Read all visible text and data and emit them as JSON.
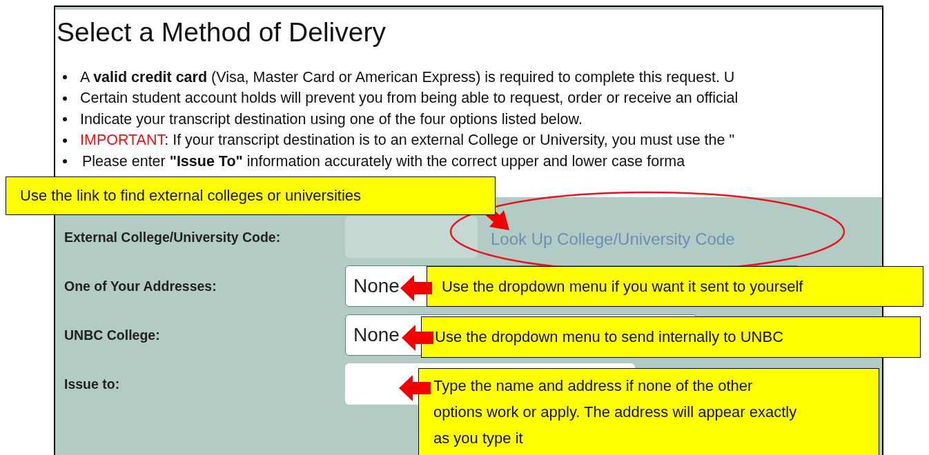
{
  "page": {
    "title": "Select a Method of Delivery",
    "instructions": [
      {
        "text": "A **valid credit card** (Visa, Master Card or American Express) is required to complete this request. U"
      },
      {
        "text": "Certain student account holds will prevent you from being able to request, order or receive an official"
      },
      {
        "text": "Indicate your transcript destination using one of the four options listed below."
      },
      {
        "alert": "IMPORTANT",
        "text": ": If your transcript destination is to an external College or University, you must use the \""
      },
      {
        "text": "Please enter **\"Issue To\"** information accurately with the correct upper and lower case forma"
      }
    ],
    "form": {
      "rows": [
        {
          "label": "External College/University Code:",
          "kind": "code",
          "disabled": true,
          "link": "Look Up College/University Code"
        },
        {
          "label": "One of Your Addresses:",
          "kind": "select",
          "value": "None"
        },
        {
          "label": "UNBC College:",
          "kind": "select",
          "value": "None"
        },
        {
          "label": "Issue to:",
          "kind": "text"
        }
      ]
    }
  },
  "annotations": [
    {
      "text": "Use the link to find external colleges or universities"
    },
    {
      "text": "Use the dropdown menu if you want it sent to yourself"
    },
    {
      "text": "Use the dropdown menu to send internally to UNBC"
    },
    {
      "text": "Type the name and address if none of the other options work or apply. The address will appear exactly as you type it"
    }
  ]
}
